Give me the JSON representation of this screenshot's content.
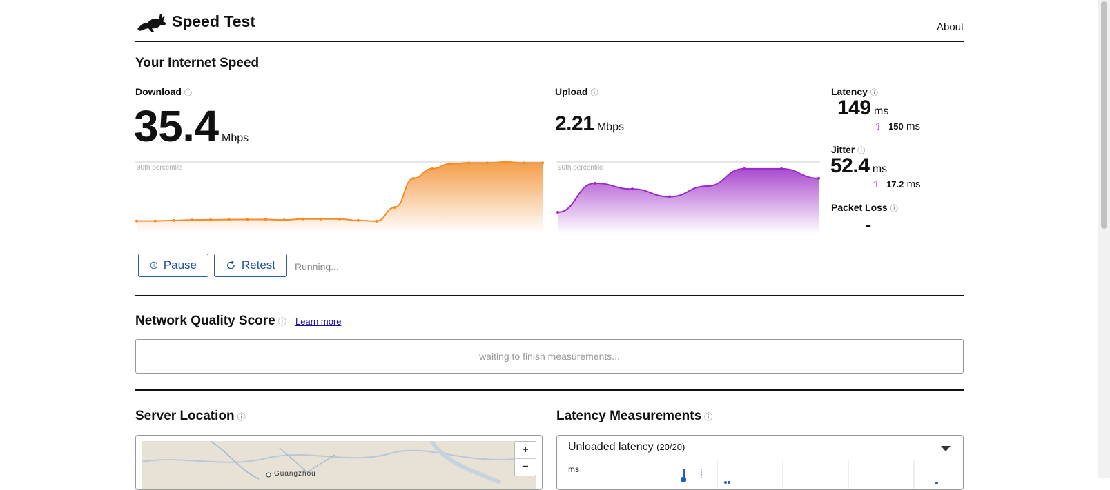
{
  "header": {
    "title": "Speed Test",
    "about_label": "About"
  },
  "section_title": "Your Internet Speed",
  "download": {
    "label": "Download",
    "info_icon": "info-icon",
    "value": "35.4",
    "unit": "Mbps",
    "percentile_label": "90th percentile",
    "color": "#f28c28",
    "series": [
      0.6,
      0.6,
      0.65,
      0.7,
      0.72,
      0.74,
      0.75,
      0.75,
      0.7,
      0.8,
      0.8,
      0.8,
      0.65,
      0.58,
      2.0,
      5.0,
      6.0,
      6.5,
      6.6,
      6.6,
      6.7,
      6.6,
      6.6
    ]
  },
  "upload": {
    "label": "Upload",
    "value": "2.21",
    "unit": "Mbps",
    "percentile_label": "90th percentile",
    "color": "#9b2bc6",
    "series": [
      1.5,
      4.5,
      3.9,
      3.1,
      4.2,
      6.0,
      6.0,
      5.0
    ]
  },
  "latency": {
    "label": "Latency",
    "value": "149",
    "unit": "ms",
    "loaded_value": "150",
    "loaded_unit": "ms"
  },
  "jitter": {
    "label": "Jitter",
    "value": "52.4",
    "unit": "ms",
    "loaded_value": "17.2",
    "loaded_unit": "ms"
  },
  "packet_loss": {
    "label": "Packet Loss",
    "value": "-"
  },
  "controls": {
    "pause_label": "Pause",
    "retest_label": "Retest",
    "status": "Running..."
  },
  "network_quality": {
    "title": "Network Quality Score",
    "learn_more": "Learn more",
    "placeholder": "waiting to finish measurements..."
  },
  "server_location": {
    "title": "Server Location",
    "map_city": "Guangzhou",
    "zoom_in": "+",
    "zoom_out": "−"
  },
  "latency_measurements": {
    "title": "Latency Measurements",
    "selected": "Unloaded latency",
    "count": "(20/20)",
    "axis_unit": "ms"
  }
}
